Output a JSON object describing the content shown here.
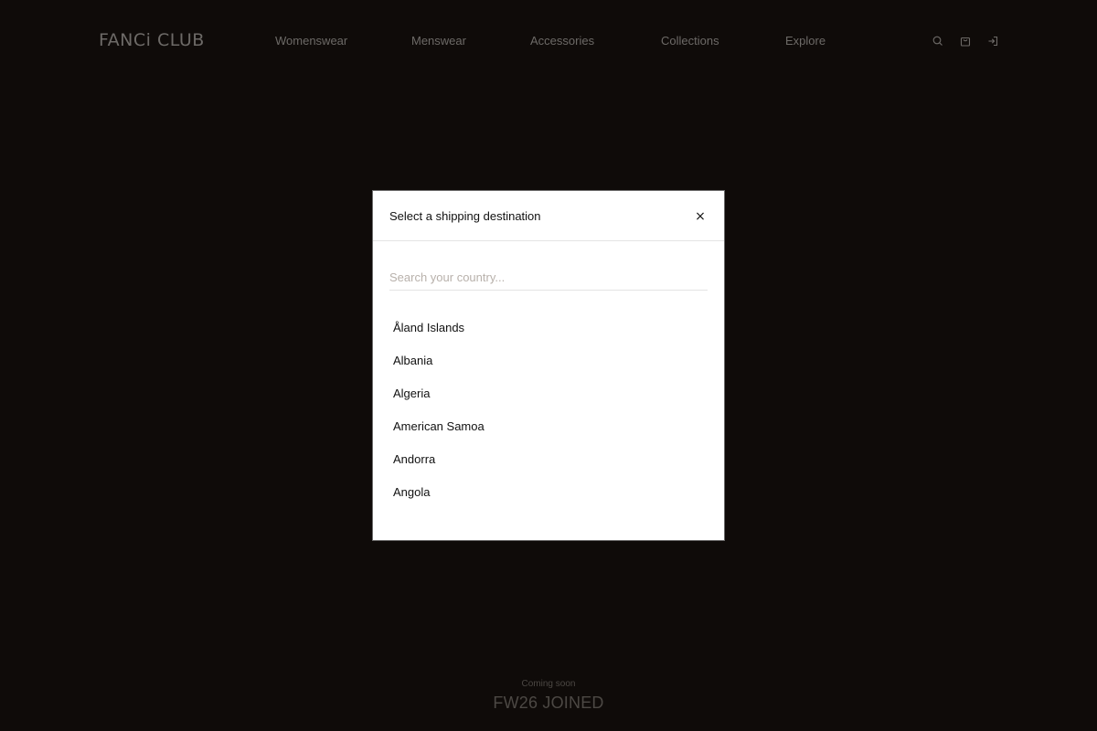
{
  "header": {
    "logo": "FANCi CLUB",
    "nav": [
      "Womenswear",
      "Menswear",
      "Accessories",
      "Collections",
      "Explore"
    ],
    "icons": [
      "search-icon",
      "bag-icon",
      "login-icon"
    ]
  },
  "teaser": {
    "label": "Coming soon",
    "title": "FW26 JOINED"
  },
  "modal": {
    "title": "Select a shipping destination",
    "close_label": "×",
    "search_placeholder": "Search your country...",
    "search_value": "",
    "countries": [
      "Åland Islands",
      "Albania",
      "Algeria",
      "American Samoa",
      "Andorra",
      "Angola"
    ]
  },
  "colors": {
    "background": "#0f0b09",
    "header_text": "#6d6a67",
    "modal_background": "#ffffff",
    "modal_text": "#111111",
    "placeholder": "#b8b1ab"
  }
}
